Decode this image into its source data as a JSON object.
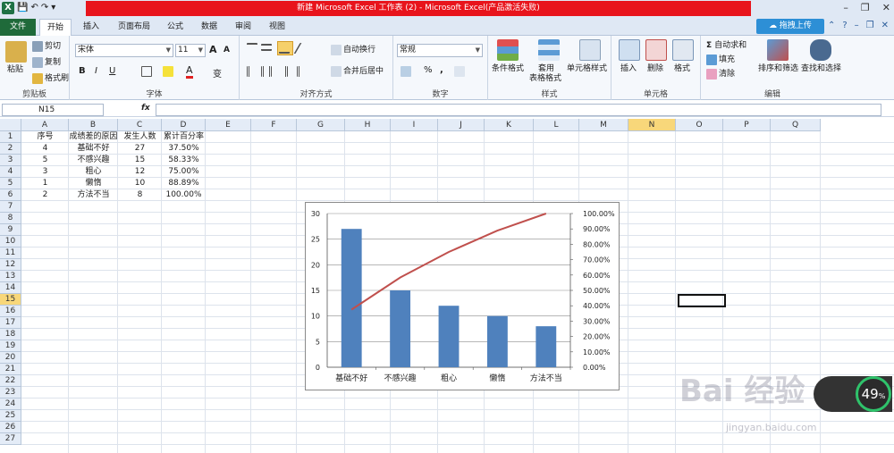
{
  "window": {
    "title": "新建 Microsoft Excel 工作表 (2) - Microsoft Excel(产品激活失败)",
    "upload_button": "拖拽上传",
    "qat_logo": "X"
  },
  "tabs": [
    "文件",
    "开始",
    "插入",
    "页面布局",
    "公式",
    "数据",
    "审阅",
    "视图"
  ],
  "ribbon": {
    "clipboard": {
      "label": "剪贴板",
      "paste": "粘贴",
      "cut": "剪切",
      "copy": "复制",
      "format_painter": "格式刷"
    },
    "font": {
      "label": "字体",
      "font_name": "宋体",
      "font_size": "11",
      "bold": "B",
      "italic": "I",
      "underline": "U",
      "grow": "A",
      "shrink": "A",
      "color_a": "A",
      "wen": "变"
    },
    "alignment": {
      "label": "对齐方式",
      "wrap": "自动换行",
      "merge": "合并后居中"
    },
    "number": {
      "label": "数字",
      "format": "常规",
      "percent": "%",
      "comma": ","
    },
    "styles": {
      "label": "样式",
      "conditional": "条件格式",
      "table_format_1": "套用",
      "table_format_2": "表格格式",
      "cell_styles": "单元格样式"
    },
    "cells": {
      "label": "单元格",
      "insert": "插入",
      "delete": "删除",
      "format": "格式"
    },
    "editing": {
      "label": "编辑",
      "autosum": "自动求和",
      "fill": "填充",
      "clear": "清除",
      "sort": "排序和筛选",
      "find": "查找和选择"
    }
  },
  "formula_bar": {
    "name_box": "N15",
    "fx": "fx",
    "value": ""
  },
  "columns": [
    "A",
    "B",
    "C",
    "D",
    "E",
    "F",
    "G",
    "H",
    "I",
    "J",
    "K",
    "L",
    "M",
    "N",
    "O",
    "P",
    "Q"
  ],
  "rows": [
    "1",
    "2",
    "3",
    "4",
    "5",
    "6",
    "7",
    "8",
    "9",
    "10",
    "11",
    "12",
    "13",
    "14",
    "15",
    "16",
    "17",
    "18",
    "19",
    "20",
    "21",
    "22",
    "23",
    "24",
    "25",
    "26",
    "27"
  ],
  "table": {
    "headers": [
      "序号",
      "成绩差的原因",
      "发生人数",
      "累计百分率"
    ],
    "rows": [
      [
        "4",
        "基础不好",
        "27",
        "37.50%"
      ],
      [
        "5",
        "不感兴趣",
        "15",
        "58.33%"
      ],
      [
        "3",
        "粗心",
        "12",
        "75.00%"
      ],
      [
        "1",
        "懒惰",
        "10",
        "88.89%"
      ],
      [
        "2",
        "方法不当",
        "8",
        "100.00%"
      ]
    ]
  },
  "chart_data": {
    "type": "bar",
    "categories": [
      "基础不好",
      "不感兴趣",
      "粗心",
      "懒惰",
      "方法不当"
    ],
    "series": [
      {
        "type": "bar",
        "values": [
          27,
          15,
          12,
          10,
          8
        ],
        "color": "#4f81bd",
        "axis": "left"
      },
      {
        "type": "line",
        "values": [
          37.5,
          58.33,
          75.0,
          88.89,
          100.0
        ],
        "color": "#c0504d",
        "axis": "right"
      }
    ],
    "ylim": [
      0,
      30
    ],
    "yticks": [
      "0",
      "5",
      "10",
      "15",
      "20",
      "25",
      "30"
    ],
    "y2lim": [
      0,
      100
    ],
    "y2ticks": [
      "0.00%",
      "10.00%",
      "20.00%",
      "30.00%",
      "40.00%",
      "50.00%",
      "60.00%",
      "70.00%",
      "80.00%",
      "90.00%",
      "100.00%"
    ],
    "grid": true,
    "legend": "none"
  },
  "overlay": {
    "watermark": "Bai 经验",
    "watermark_sub": "jingyan.baidu.com",
    "speed_percent": "49",
    "speed_unit": "%"
  }
}
